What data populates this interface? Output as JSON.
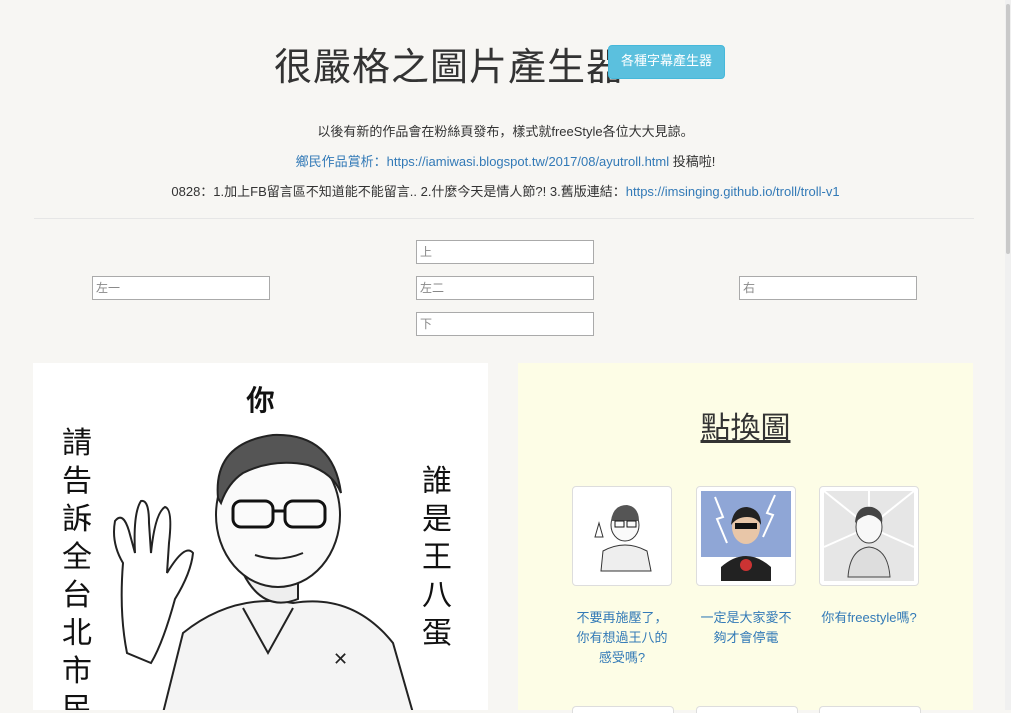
{
  "header": {
    "title": "很嚴格之圖片產生器",
    "generator_button": "各種字幕產生器"
  },
  "info": {
    "line1": "以後有新的作品會在粉絲頁發布，樣式就freeStyle各位大大見諒。",
    "line2_link": "鄉民作品賞析：https://iamiwasi.blogspot.tw/2017/08/ayutroll.html",
    "line2_suffix": " 投稿啦!",
    "line3_prefix": "0828：1.加上FB留言區不知道能不能留言.. 2.什麼今天是情人節?! 3.舊版連結：",
    "line3_link": "https://imsinging.github.io/troll/troll-v1"
  },
  "inputs": {
    "top": "上",
    "left1": "左一",
    "left2": "左二",
    "right": "右",
    "bottom": "下"
  },
  "meme": {
    "top": "你",
    "left": "請告訴全台北市民",
    "right": "誰是王八蛋"
  },
  "panel": {
    "title": "點換圖",
    "thumbs": [
      {
        "caption": "不要再施壓了，你有想過王八的感受嗎?"
      },
      {
        "caption": "一定是大家愛不夠才會停電"
      },
      {
        "caption": "你有freestyle嗎?"
      }
    ]
  }
}
